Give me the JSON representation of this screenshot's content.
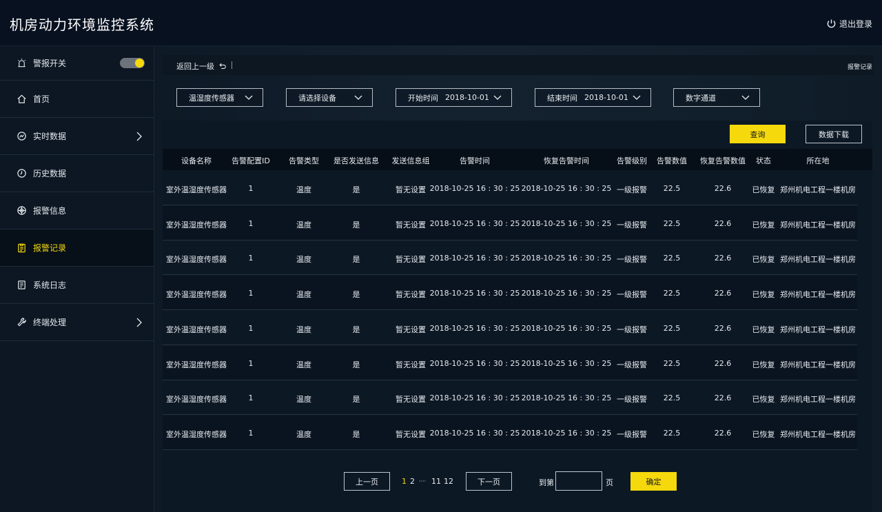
{
  "header": {
    "title": "机房动力环境监控系统",
    "logout": "退出登录"
  },
  "sidebar": {
    "alarm_switch": {
      "label": "警报开关",
      "on": true
    },
    "items": [
      {
        "label": "首页",
        "icon": "home-icon",
        "active": false,
        "has_submenu": false
      },
      {
        "label": "实时数据",
        "icon": "realtime-data-icon",
        "active": false,
        "has_submenu": true
      },
      {
        "label": "历史数据",
        "icon": "clock-icon",
        "active": false,
        "has_submenu": false
      },
      {
        "label": "报警信息",
        "icon": "alarm-info-icon",
        "active": false,
        "has_submenu": false
      },
      {
        "label": "报警记录",
        "icon": "clipboard-icon",
        "active": true,
        "has_submenu": false
      },
      {
        "label": "系统日志",
        "icon": "log-icon",
        "active": false,
        "has_submenu": false
      },
      {
        "label": "终端处理",
        "icon": "wrench-icon",
        "active": false,
        "has_submenu": true
      }
    ]
  },
  "breadcrumb": {
    "back": "返回上一级",
    "current": "报警记录"
  },
  "filters": {
    "sensor": "温湿度传感器",
    "device": "请选择设备",
    "start": {
      "label": "开始时间",
      "value": "2018-10-01"
    },
    "end": {
      "label": "结束时间",
      "value": "2018-10-01"
    },
    "channel": "数字通道"
  },
  "actions": {
    "query": "查询",
    "download": "数据下载"
  },
  "table": {
    "columns": [
      "设备名称",
      "告警配置ID",
      "告警类型",
      "是否发送信息",
      "发送信息组",
      "告警时间",
      "恢复告警时间",
      "告警级别",
      "告警数值",
      "恢复告警数值",
      "状态",
      "所在地"
    ],
    "rows": [
      [
        "室外温湿度传感器",
        "1",
        "温度",
        "是",
        "暂无设置",
        "2018-10-25 16 : 30 : 25",
        "2018-10-25 16 : 30 : 25",
        "一级报警",
        "22.5",
        "22.6",
        "已恢复",
        "郑州机电工程一楼机房"
      ],
      [
        "室外温湿度传感器",
        "1",
        "温度",
        "是",
        "暂无设置",
        "2018-10-25 16 : 30 : 25",
        "2018-10-25 16 : 30 : 25",
        "一级报警",
        "22.5",
        "22.6",
        "已恢复",
        "郑州机电工程一楼机房"
      ],
      [
        "室外温湿度传感器",
        "1",
        "温度",
        "是",
        "暂无设置",
        "2018-10-25 16 : 30 : 25",
        "2018-10-25 16 : 30 : 25",
        "一级报警",
        "22.5",
        "22.6",
        "已恢复",
        "郑州机电工程一楼机房"
      ],
      [
        "室外温湿度传感器",
        "1",
        "温度",
        "是",
        "暂无设置",
        "2018-10-25 16 : 30 : 25",
        "2018-10-25 16 : 30 : 25",
        "一级报警",
        "22.5",
        "22.6",
        "已恢复",
        "郑州机电工程一楼机房"
      ],
      [
        "室外温湿度传感器",
        "1",
        "温度",
        "是",
        "暂无设置",
        "2018-10-25 16 : 30 : 25",
        "2018-10-25 16 : 30 : 25",
        "一级报警",
        "22.5",
        "22.6",
        "已恢复",
        "郑州机电工程一楼机房"
      ],
      [
        "室外温湿度传感器",
        "1",
        "温度",
        "是",
        "暂无设置",
        "2018-10-25 16 : 30 : 25",
        "2018-10-25 16 : 30 : 25",
        "一级报警",
        "22.5",
        "22.6",
        "已恢复",
        "郑州机电工程一楼机房"
      ],
      [
        "室外温湿度传感器",
        "1",
        "温度",
        "是",
        "暂无设置",
        "2018-10-25 16 : 30 : 25",
        "2018-10-25 16 : 30 : 25",
        "一级报警",
        "22.5",
        "22.6",
        "已恢复",
        "郑州机电工程一楼机房"
      ],
      [
        "室外温湿度传感器",
        "1",
        "温度",
        "是",
        "暂无设置",
        "2018-10-25 16 : 30 : 25",
        "2018-10-25 16 : 30 : 25",
        "一级报警",
        "22.5",
        "22.6",
        "已恢复",
        "郑州机电工程一楼机房"
      ]
    ]
  },
  "pagination": {
    "prev": "上一页",
    "next": "下一页",
    "pages": [
      "1",
      "2",
      "····",
      "11",
      "12"
    ],
    "current": "1",
    "goto_label": "到第",
    "goto_value": "",
    "unit": "页",
    "confirm": "确定"
  },
  "colors": {
    "accent": "#f5d90c",
    "background": "#0c1522",
    "header": "#081120"
  }
}
